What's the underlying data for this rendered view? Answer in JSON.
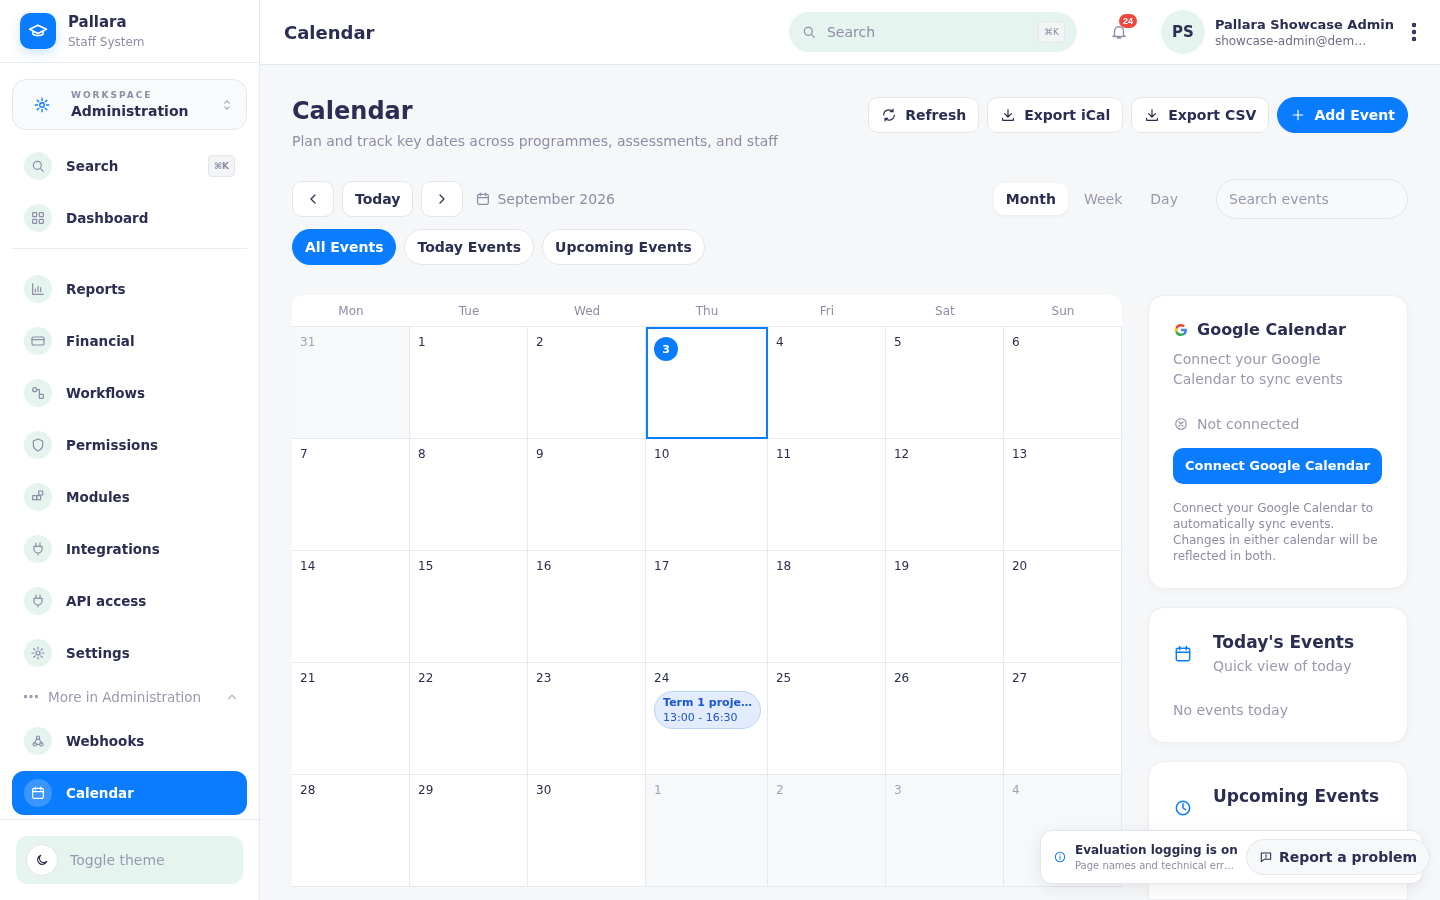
{
  "brand": {
    "name": "Pallara",
    "subtitle": "Staff System"
  },
  "workspace": {
    "label": "WORKSPACE",
    "value": "Administration"
  },
  "sidebar": {
    "search": {
      "label": "Search",
      "shortcut": "⌘K"
    },
    "primary": [
      {
        "label": "Dashboard",
        "selected": false
      }
    ],
    "items": [
      {
        "label": "Reports",
        "selected": false
      },
      {
        "label": "Financial",
        "selected": false
      },
      {
        "label": "Workflows",
        "selected": false
      },
      {
        "label": "Permissions",
        "selected": false
      },
      {
        "label": "Modules",
        "selected": false
      },
      {
        "label": "Integrations",
        "selected": false
      },
      {
        "label": "API access",
        "selected": false
      },
      {
        "label": "Settings",
        "selected": false
      }
    ],
    "more": {
      "label": "More in Administration",
      "expanded": true,
      "items": [
        {
          "label": "Webhooks",
          "selected": false
        },
        {
          "label": "Calendar",
          "selected": true
        }
      ]
    },
    "toggle_theme": "Toggle theme"
  },
  "header": {
    "title": "Calendar",
    "search": {
      "placeholder": "Search",
      "shortcut": "⌘K"
    },
    "notifications": "24",
    "user": {
      "initials": "PS",
      "name": "Pallara Showcase Admin",
      "email": "showcase-admin@dem…"
    }
  },
  "page": {
    "title": "Calendar",
    "subtitle": "Plan and track key dates across programmes, assessments, and staff",
    "actions": [
      {
        "label": "Refresh",
        "kind": "refresh"
      },
      {
        "label": "Export iCal",
        "kind": "download"
      },
      {
        "label": "Export CSV",
        "kind": "download"
      },
      {
        "label": "Add Event",
        "kind": "primary"
      }
    ]
  },
  "toolbar": {
    "today": "Today",
    "period": "September 2026",
    "views": [
      {
        "label": "Month",
        "selected": true
      },
      {
        "label": "Week",
        "selected": false
      },
      {
        "label": "Day",
        "selected": false
      }
    ],
    "search": {
      "placeholder": "Search events"
    }
  },
  "filters": [
    {
      "label": "All Events",
      "selected": true
    },
    {
      "label": "Today Events",
      "selected": false
    },
    {
      "label": "Upcoming Events",
      "selected": false
    }
  ],
  "calendar": {
    "weekdays": [
      "Mon",
      "Tue",
      "Wed",
      "Thu",
      "Fri",
      "Sat",
      "Sun"
    ],
    "weeks": [
      [
        {
          "day": "31",
          "in_month": false,
          "today": false,
          "selected": false
        },
        {
          "day": "1",
          "in_month": true,
          "today": false,
          "selected": false
        },
        {
          "day": "2",
          "in_month": true,
          "today": false,
          "selected": false
        },
        {
          "day": "3",
          "in_month": true,
          "today": true,
          "selected": true
        },
        {
          "day": "4",
          "in_month": true,
          "today": false,
          "selected": false
        },
        {
          "day": "5",
          "in_month": true,
          "today": false,
          "selected": false
        },
        {
          "day": "6",
          "in_month": true,
          "today": false,
          "selected": false
        }
      ],
      [
        {
          "day": "7",
          "in_month": true,
          "today": false,
          "selected": false
        },
        {
          "day": "8",
          "in_month": true,
          "today": false,
          "selected": false
        },
        {
          "day": "9",
          "in_month": true,
          "today": false,
          "selected": false
        },
        {
          "day": "10",
          "in_month": true,
          "today": false,
          "selected": false
        },
        {
          "day": "11",
          "in_month": true,
          "today": false,
          "selected": false
        },
        {
          "day": "12",
          "in_month": true,
          "today": false,
          "selected": false
        },
        {
          "day": "13",
          "in_month": true,
          "today": false,
          "selected": false
        }
      ],
      [
        {
          "day": "14",
          "in_month": true,
          "today": false,
          "selected": false
        },
        {
          "day": "15",
          "in_month": true,
          "today": false,
          "selected": false
        },
        {
          "day": "16",
          "in_month": true,
          "today": false,
          "selected": false
        },
        {
          "day": "17",
          "in_month": true,
          "today": false,
          "selected": false
        },
        {
          "day": "18",
          "in_month": true,
          "today": false,
          "selected": false
        },
        {
          "day": "19",
          "in_month": true,
          "today": false,
          "selected": false
        },
        {
          "day": "20",
          "in_month": true,
          "today": false,
          "selected": false
        }
      ],
      [
        {
          "day": "21",
          "in_month": true,
          "today": false,
          "selected": false
        },
        {
          "day": "22",
          "in_month": true,
          "today": false,
          "selected": false
        },
        {
          "day": "23",
          "in_month": true,
          "today": false,
          "selected": false
        },
        {
          "day": "24",
          "in_month": true,
          "today": false,
          "selected": false,
          "events": [
            {
              "title": "Term 1 proje…",
              "time": "13:00 - 16:30"
            }
          ]
        },
        {
          "day": "25",
          "in_month": true,
          "today": false,
          "selected": false
        },
        {
          "day": "26",
          "in_month": true,
          "today": false,
          "selected": false
        },
        {
          "day": "27",
          "in_month": true,
          "today": false,
          "selected": false
        }
      ],
      [
        {
          "day": "28",
          "in_month": true,
          "today": false,
          "selected": false
        },
        {
          "day": "29",
          "in_month": true,
          "today": false,
          "selected": false
        },
        {
          "day": "30",
          "in_month": true,
          "today": false,
          "selected": false
        },
        {
          "day": "1",
          "in_month": false,
          "today": false,
          "selected": false
        },
        {
          "day": "2",
          "in_month": false,
          "today": false,
          "selected": false
        },
        {
          "day": "3",
          "in_month": false,
          "today": false,
          "selected": false
        },
        {
          "day": "4",
          "in_month": false,
          "today": false,
          "selected": false
        }
      ]
    ]
  },
  "google": {
    "title": "Google Calendar",
    "description": "Connect your Google Calendar to sync events",
    "connected": false,
    "status": "Not connected",
    "button": "Connect Google Calendar",
    "note": "Connect your Google Calendar to automatically sync events. Changes in either calendar will be reflected in both."
  },
  "today_card": {
    "title": "Today's Events",
    "subtitle": "Quick view of today",
    "empty": "No events today"
  },
  "upcoming_card": {
    "title": "Upcoming Events"
  },
  "toast": {
    "title": "Evaluation logging is on",
    "text": "Page names and technical err…",
    "button": "Report a problem"
  }
}
